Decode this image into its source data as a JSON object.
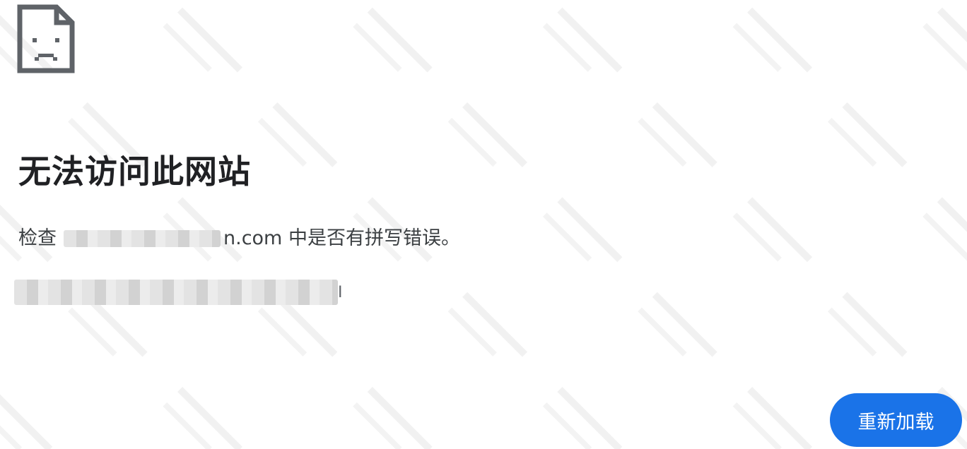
{
  "error_page": {
    "icon": "sad-page-icon",
    "title": "无法访问此网站",
    "message_prefix": "检查",
    "message_suffix": "n.com 中是否有拼写错误。",
    "error_code_tail": "I",
    "reload_label": "重新加载"
  },
  "colors": {
    "accent": "#1a73e8",
    "title": "#202124",
    "text": "#3c4043",
    "icon": "#5f6368"
  }
}
